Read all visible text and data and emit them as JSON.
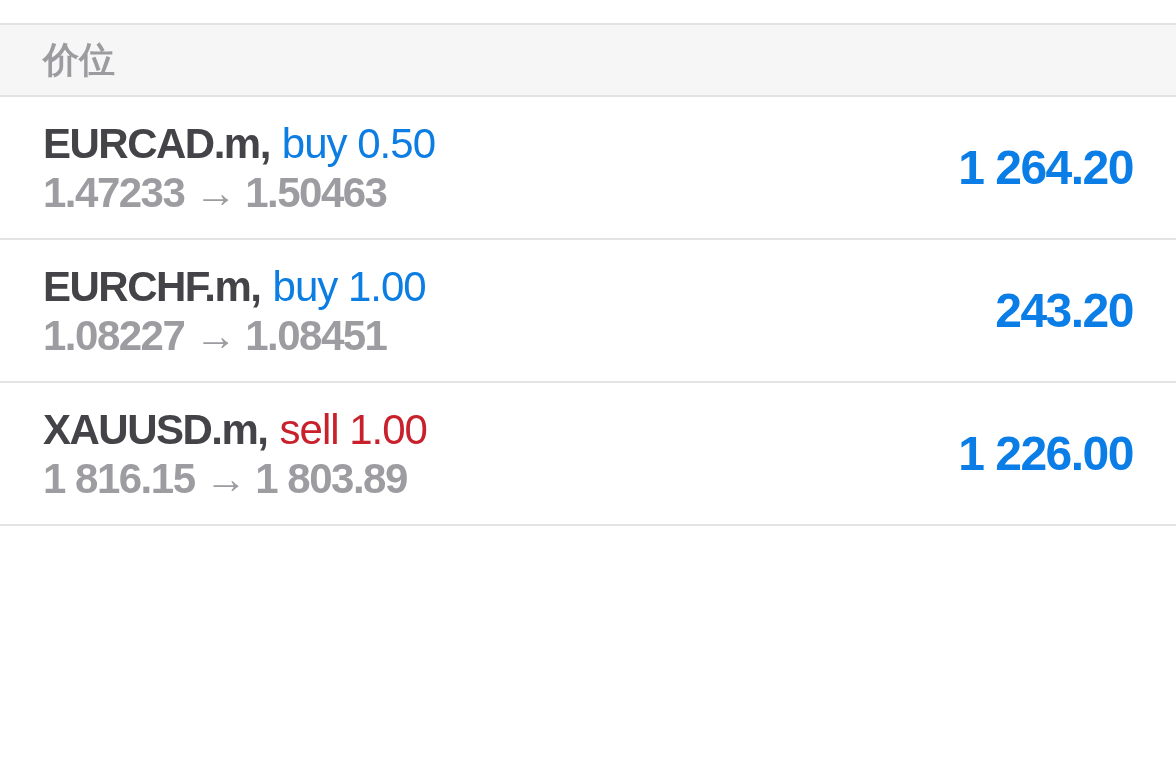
{
  "header": {
    "title": "价位"
  },
  "positions": [
    {
      "symbol": "EURCAD.m,",
      "kind": "buy",
      "order": "buy 0.50",
      "prices": "1.47233 → 1.50463",
      "profit": "1 264.20"
    },
    {
      "symbol": "EURCHF.m,",
      "kind": "buy",
      "order": "buy 1.00",
      "prices": "1.08227 → 1.08451",
      "profit": "243.20"
    },
    {
      "symbol": "XAUUSD.m,",
      "kind": "sell",
      "order": "sell 1.00",
      "prices": "1 816.15 → 1 803.89",
      "profit": "1 226.00"
    }
  ]
}
